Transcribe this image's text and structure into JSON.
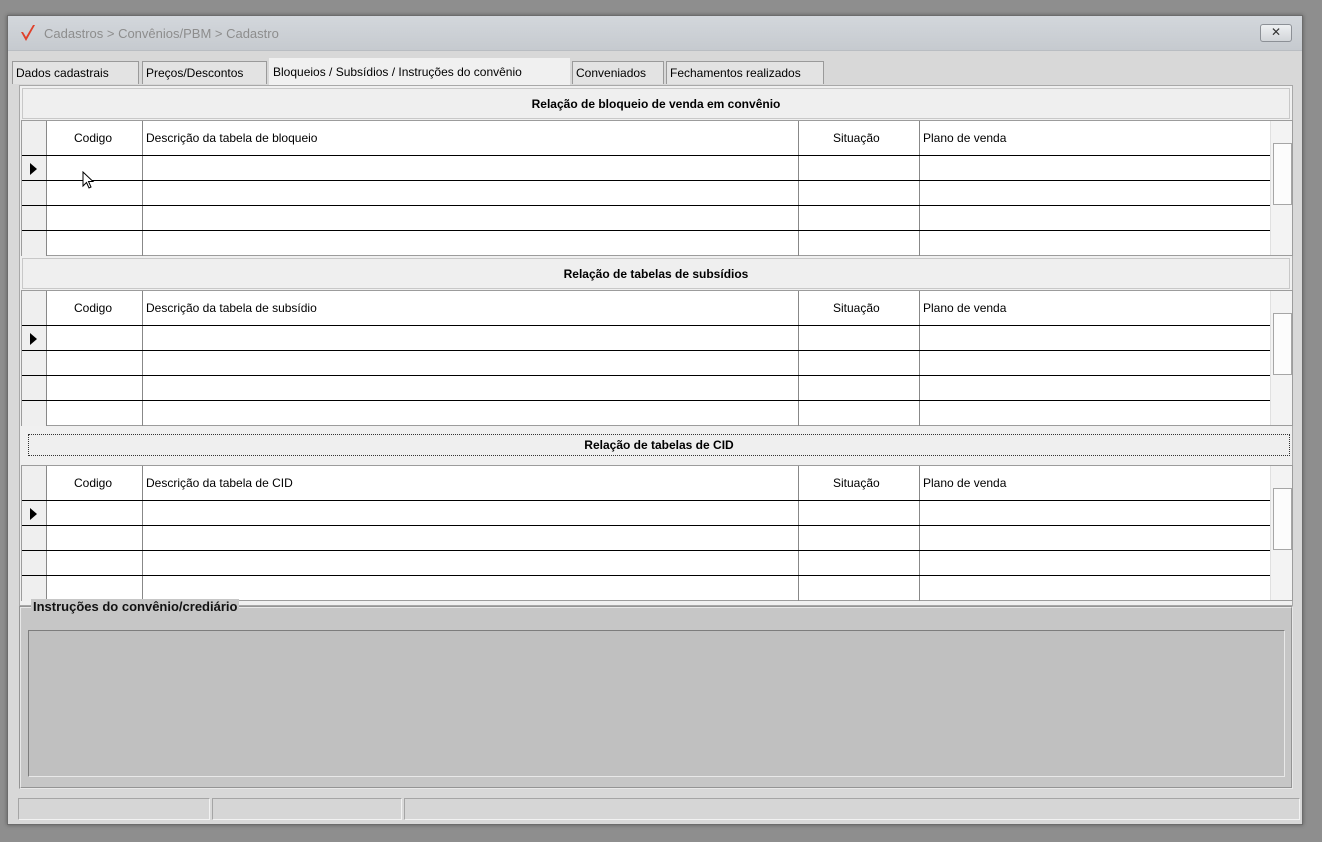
{
  "window": {
    "title": "Cadastros > Convênios/PBM > Cadastro",
    "close_label": "✕"
  },
  "tabs": [
    {
      "label": "Dados cadastrais",
      "active": false
    },
    {
      "label": "Preços/Descontos",
      "active": false
    },
    {
      "label": "Bloqueios / Subsídios / Instruções do convênio",
      "active": true
    },
    {
      "label": "Conveniados",
      "active": false
    },
    {
      "label": "Fechamentos realizados",
      "active": false
    }
  ],
  "sections": [
    {
      "title": "Relação de bloqueio de venda em convênio",
      "columns": [
        "Codigo",
        "Descrição da tabela de bloqueio",
        "Situação",
        "Plano de venda"
      ],
      "rows": [
        [
          "",
          "",
          "",
          ""
        ],
        [
          "",
          "",
          "",
          ""
        ],
        [
          "",
          "",
          "",
          ""
        ],
        [
          "",
          "",
          "",
          ""
        ]
      ]
    },
    {
      "title": "Relação de tabelas de subsídios",
      "columns": [
        "Codigo",
        "Descrição da tabela de subsídio",
        "Situação",
        "Plano de venda"
      ],
      "rows": [
        [
          "",
          "",
          "",
          ""
        ],
        [
          "",
          "",
          "",
          ""
        ],
        [
          "",
          "",
          "",
          ""
        ],
        [
          "",
          "",
          "",
          ""
        ]
      ]
    },
    {
      "title": "Relação de tabelas de CID",
      "columns": [
        "Codigo",
        "Descrição da tabela de CID",
        "Situação",
        "Plano de venda"
      ],
      "rows": [
        [
          "",
          "",
          "",
          ""
        ],
        [
          "",
          "",
          "",
          ""
        ],
        [
          "",
          "",
          "",
          ""
        ],
        [
          "",
          "",
          "",
          ""
        ]
      ]
    }
  ],
  "instructions": {
    "label": "Instruções do convênio/crediário",
    "value": ""
  },
  "colors": {
    "accent_check": "#e0402a"
  }
}
